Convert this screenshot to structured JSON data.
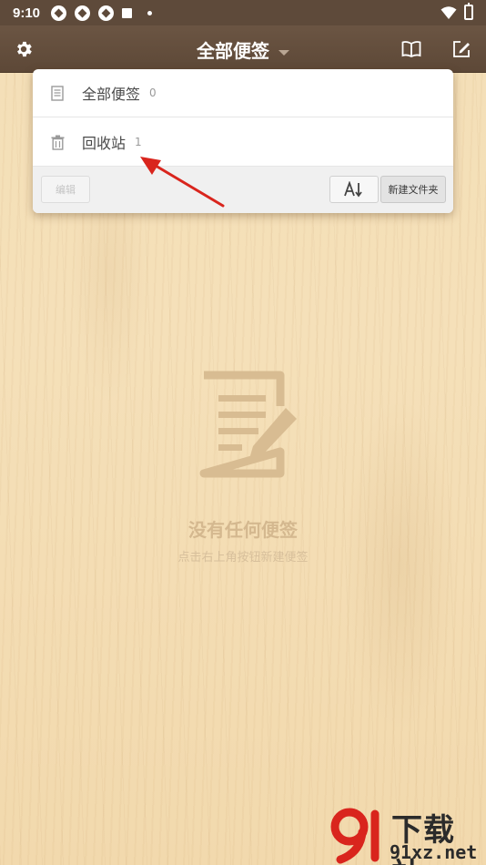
{
  "status_bar": {
    "time": "9:10"
  },
  "toolbar": {
    "title": "全部便签"
  },
  "dropdown": {
    "items": [
      {
        "label": "全部便签",
        "count": "0",
        "icon": "note-icon"
      },
      {
        "label": "回收站",
        "count": "1",
        "icon": "trash-icon"
      }
    ],
    "edit_label": "编辑",
    "sort_label": "A↓",
    "new_folder_label": "新建文件夹"
  },
  "empty_state": {
    "title": "没有任何便签",
    "subtitle": "点击右上角按钮新建便签"
  },
  "watermark": {
    "top": "下载站",
    "bottom": "91xz.net"
  },
  "colors": {
    "toolbar": "#5d4837",
    "arrow": "#d9251d",
    "accent_text": "#d4b88f"
  }
}
